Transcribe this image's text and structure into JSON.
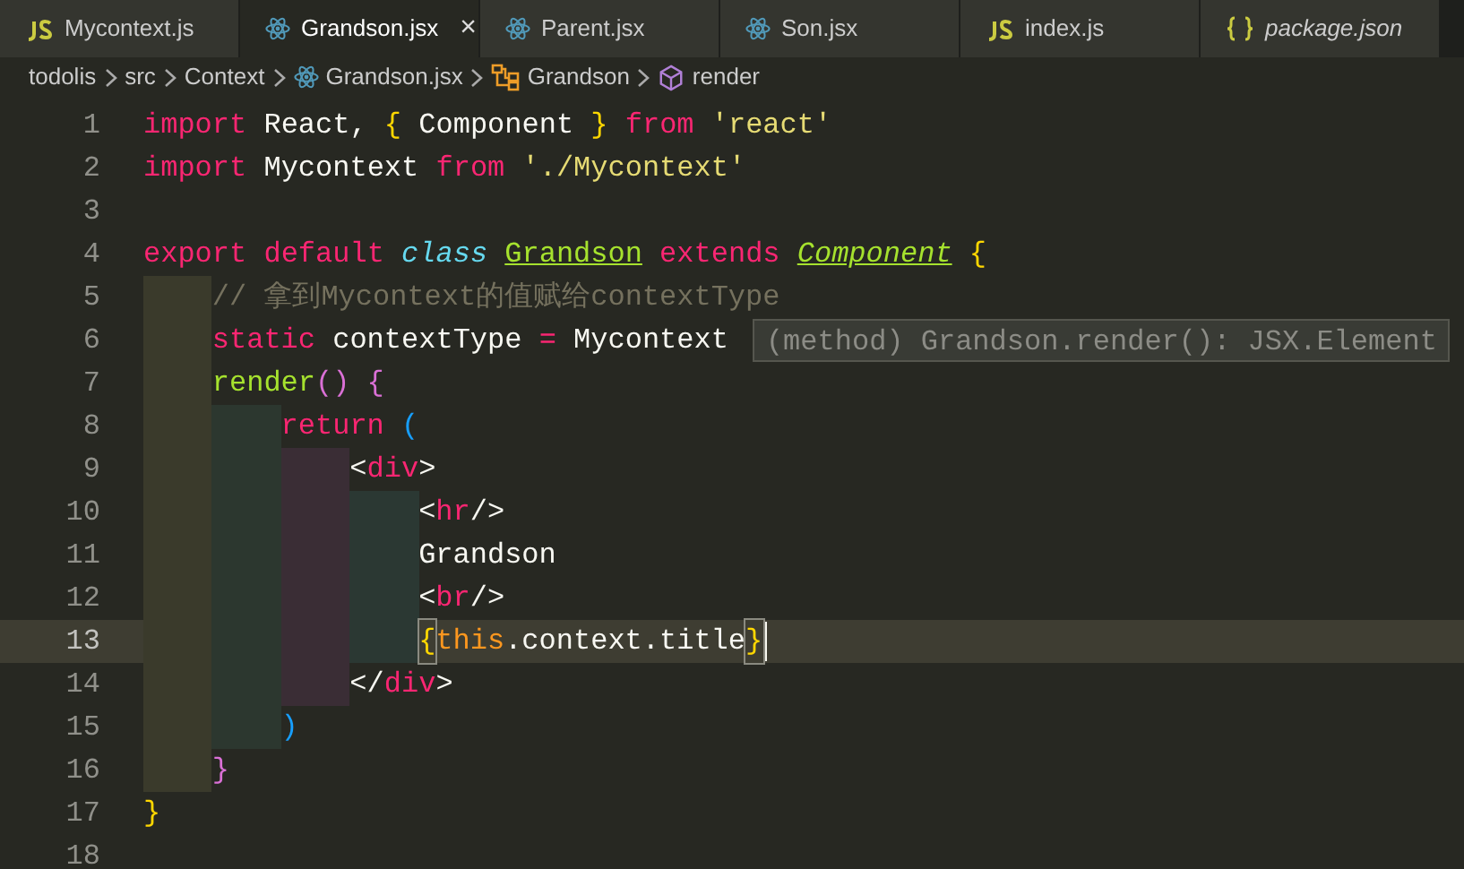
{
  "tabs": [
    {
      "label": "Mycontext.js",
      "kind": "js",
      "selected": false,
      "preview": false
    },
    {
      "label": "Grandson.jsx",
      "kind": "react",
      "selected": true,
      "preview": false,
      "close": "×"
    },
    {
      "label": "Parent.jsx",
      "kind": "react",
      "selected": false,
      "preview": false
    },
    {
      "label": "Son.jsx",
      "kind": "react",
      "selected": false,
      "preview": false
    },
    {
      "label": "index.js",
      "kind": "js",
      "selected": false,
      "preview": false
    },
    {
      "label": "package.json",
      "kind": "json",
      "selected": false,
      "preview": true
    }
  ],
  "breadcrumbs": [
    {
      "label": "todolis",
      "kind": "folder"
    },
    {
      "label": "src",
      "kind": "folder"
    },
    {
      "label": "Context",
      "kind": "folder"
    },
    {
      "label": "Grandson.jsx",
      "kind": "react"
    },
    {
      "label": "Grandson",
      "kind": "class"
    },
    {
      "label": "render",
      "kind": "method"
    }
  ],
  "editor": {
    "lines": [
      {
        "number": "1",
        "current": false,
        "tokens": [
          {
            "text": "import",
            "kind": "kw"
          },
          {
            "text": " React, ",
            "kind": "plain"
          },
          {
            "text": "{",
            "kind": "brace"
          },
          {
            "text": " Component ",
            "kind": "plain"
          },
          {
            "text": "}",
            "kind": "brace"
          },
          {
            "text": " from ",
            "kind": "kw"
          },
          {
            "text": "'react'",
            "kind": "str"
          }
        ]
      },
      {
        "number": "2",
        "current": false,
        "tokens": [
          {
            "text": "import",
            "kind": "kw"
          },
          {
            "text": " Mycontext ",
            "kind": "plain"
          },
          {
            "text": "from",
            "kind": "kw"
          },
          {
            "text": " './Mycontext'",
            "kind": "str"
          }
        ]
      },
      {
        "number": "3",
        "current": false
      },
      {
        "number": "4",
        "current": false,
        "tokens": [
          {
            "text": "export default ",
            "kind": "kw"
          },
          {
            "text": "class ",
            "kind": "storage"
          },
          {
            "text": "Grandson",
            "kind": "cls"
          },
          {
            "text": " extends ",
            "kind": "kw"
          },
          {
            "text": "Component",
            "kind": "inherit"
          },
          {
            "text": " {",
            "kind": "brace"
          }
        ]
      },
      {
        "number": "5",
        "current": false,
        "tokens": [
          {
            "text": "    // 拿到Mycontext的值赋给contextType",
            "kind": "comment"
          }
        ]
      },
      {
        "number": "6",
        "current": false,
        "tokens": [
          {
            "text": "    static",
            "kind": "kw"
          },
          {
            "text": " contextType ",
            "kind": "plain"
          },
          {
            "text": "=",
            "kind": "kw"
          },
          {
            "text": " Mycontext",
            "kind": "plain"
          }
        ],
        "hover": "(method) Grandson.render(): JSX.Element"
      },
      {
        "number": "7",
        "current": false,
        "tokens": [
          {
            "text": "    render",
            "kind": "fn"
          },
          {
            "text": "() {",
            "kind": "paren2"
          }
        ]
      },
      {
        "number": "8",
        "current": false,
        "tokens": [
          {
            "text": "        return",
            "kind": "kw"
          },
          {
            "text": " (",
            "kind": "paren3"
          }
        ]
      },
      {
        "number": "9",
        "current": false,
        "tokens": [
          {
            "text": "            <",
            "kind": "plain"
          },
          {
            "text": "div",
            "kind": "kw"
          },
          {
            "text": ">",
            "kind": "plain"
          }
        ]
      },
      {
        "number": "10",
        "current": false,
        "tokens": [
          {
            "text": "                <",
            "kind": "plain"
          },
          {
            "text": "hr",
            "kind": "kw"
          },
          {
            "text": "/>",
            "kind": "plain"
          }
        ]
      },
      {
        "number": "11",
        "current": false,
        "tokens": [
          {
            "text": "                Grandson",
            "kind": "plain"
          }
        ]
      },
      {
        "number": "12",
        "current": false,
        "tokens": [
          {
            "text": "                <",
            "kind": "plain"
          },
          {
            "text": "br",
            "kind": "kw"
          },
          {
            "text": "/>",
            "kind": "plain"
          }
        ]
      },
      {
        "number": "13",
        "current": true,
        "cursor": true,
        "tokens": [
          {
            "text": "                {",
            "kind": "matched"
          },
          {
            "text": "this",
            "kind": "this"
          },
          {
            "text": ".context.title",
            "kind": "plain"
          },
          {
            "text": "}",
            "kind": "matched"
          }
        ]
      },
      {
        "number": "14",
        "current": false,
        "tokens": [
          {
            "text": "            </",
            "kind": "plain"
          },
          {
            "text": "div",
            "kind": "kw"
          },
          {
            "text": ">",
            "kind": "plain"
          }
        ]
      },
      {
        "number": "15",
        "current": false,
        "tokens": [
          {
            "text": "        )",
            "kind": "paren3"
          }
        ]
      },
      {
        "number": "16",
        "current": false,
        "tokens": [
          {
            "text": "    }",
            "kind": "paren2"
          }
        ]
      },
      {
        "number": "17",
        "current": false,
        "tokens": [
          {
            "text": "}",
            "kind": "brace"
          }
        ]
      },
      {
        "number": "18",
        "current": false
      }
    ]
  }
}
